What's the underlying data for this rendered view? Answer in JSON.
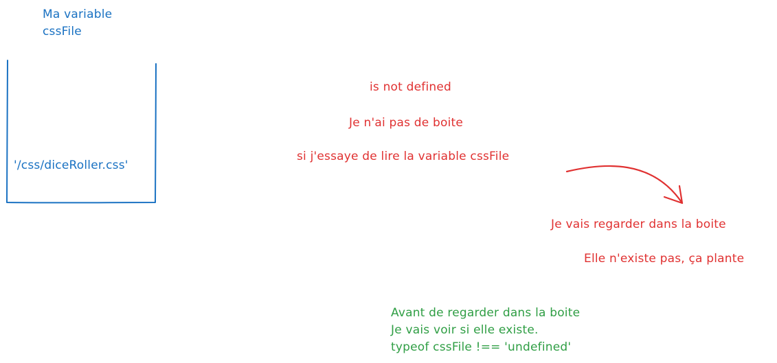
{
  "variable": {
    "title_line1": "Ma variable",
    "title_line2": "cssFile",
    "value": "'/css/diceRoller.css'"
  },
  "undefined_case": {
    "line1": "is not defined",
    "line2": "Je n'ai pas de boite",
    "line3": "si j'essaye de lire la variable cssFile",
    "line4": "Je vais regarder dans la boite",
    "line5": "Elle n'existe pas, ça plante"
  },
  "solution": {
    "line1": "Avant de regarder dans la boite",
    "line2": "Je vais voir si elle existe.",
    "line3": "typeof cssFile !== 'undefined'"
  },
  "colors": {
    "blue": "#1971c2",
    "red": "#e03131",
    "green": "#2f9e44"
  }
}
